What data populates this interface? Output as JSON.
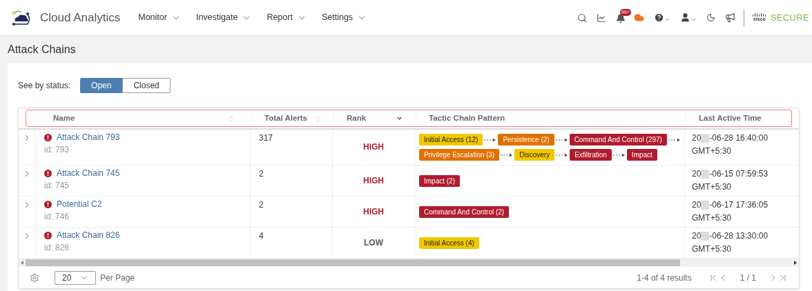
{
  "app": {
    "title": "Cloud Analytics"
  },
  "nav": [
    {
      "label": "Monitor"
    },
    {
      "label": "Investigate"
    },
    {
      "label": "Report"
    },
    {
      "label": "Settings"
    }
  ],
  "notifications": {
    "badge": "99+"
  },
  "brand": {
    "secure": "SECURE",
    "logo_word": "cisco"
  },
  "page": {
    "title": "Attack Chains"
  },
  "status_filter": {
    "label": "See by status:",
    "options": [
      {
        "label": "Open",
        "selected": true
      },
      {
        "label": "Closed",
        "selected": false
      }
    ]
  },
  "table": {
    "columns": [
      {
        "label": "Name",
        "sortable": true
      },
      {
        "label": "Total Alerts",
        "sortable": true
      },
      {
        "label": "Rank",
        "sortable": false
      },
      {
        "label": "Tactic Chain Pattern",
        "sortable": false
      },
      {
        "label": "Last Active Time",
        "sortable": false
      }
    ],
    "rows": [
      {
        "name": "Attack Chain 793",
        "id": "id: 793",
        "total_alerts": "317",
        "rank": {
          "label": "HIGH",
          "color": "#b01c2e"
        },
        "tactics": [
          [
            {
              "label": "Initial Access (12)",
              "color": "#f0c800"
            },
            {
              "label": "Persistence (2)",
              "color": "#e07000"
            },
            {
              "label": "Command And Control (297)",
              "color": "#b01c2e"
            }
          ],
          [
            {
              "label": "Privilege Escalation (3)",
              "color": "#e07000"
            },
            {
              "label": "Discovery",
              "color": "#f0c800"
            },
            {
              "label": "Exfiltration",
              "color": "#b01c2e"
            },
            {
              "label": "Impact",
              "color": "#b01c2e"
            }
          ]
        ],
        "trailing_arrow": true,
        "time_start": "20",
        "time_end": "-06-28 16:40:00",
        "timezone": "GMT+5:30"
      },
      {
        "name": "Attack Chain 745",
        "id": "id: 745",
        "total_alerts": "2",
        "rank": {
          "label": "HIGH",
          "color": "#b01c2e"
        },
        "tactics": [
          [
            {
              "label": "Impact (2)",
              "color": "#b01c2e"
            }
          ]
        ],
        "trailing_arrow": false,
        "time_start": "20",
        "time_end": "-06-15 07:59:53",
        "timezone": "GMT+5:30"
      },
      {
        "name": "Potential C2",
        "id": "id: 746",
        "total_alerts": "2",
        "rank": {
          "label": "HIGH",
          "color": "#b01c2e"
        },
        "tactics": [
          [
            {
              "label": "Command And Control (2)",
              "color": "#b01c2e"
            }
          ]
        ],
        "trailing_arrow": false,
        "time_start": "20",
        "time_end": "-06-17 17:36:05",
        "timezone": "GMT+5:30"
      },
      {
        "name": "Attack Chain 826",
        "id": "id: 826",
        "total_alerts": "4",
        "rank": {
          "label": "LOW",
          "color": "#555555"
        },
        "tactics": [
          [
            {
              "label": "Initial Access (4)",
              "color": "#f0c800"
            }
          ]
        ],
        "trailing_arrow": false,
        "time_start": "20",
        "time_end": "-06-28 13:30:00",
        "timezone": "GMT+5:30"
      }
    ]
  },
  "footer": {
    "page_size": "20",
    "per_page": "Per Page",
    "results": "1-4 of 4 results",
    "page": "1 / 1"
  }
}
